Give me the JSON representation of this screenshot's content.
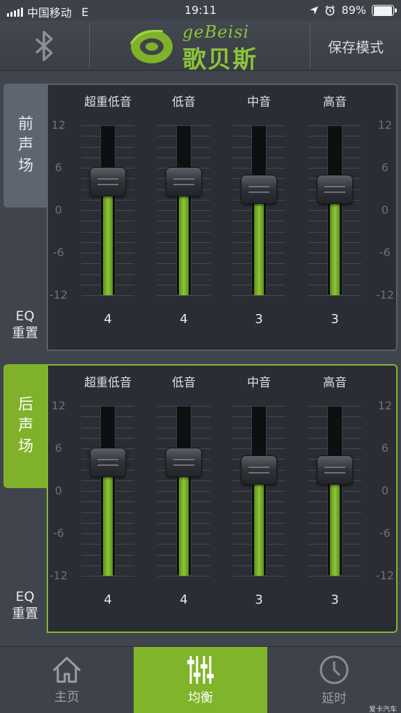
{
  "status_bar": {
    "carrier": "中国移动",
    "network": "E",
    "time": "19:11",
    "battery": "89%",
    "battery_level": 0.89
  },
  "header": {
    "bluetooth_icon": "bluetooth-icon",
    "brand_en": "geBeisi",
    "brand_cn": "歌贝斯",
    "mode_label": "保存模式",
    "accent": "#7fb22a"
  },
  "eq": {
    "scale_labels": [
      "12",
      "6",
      "0",
      "-6",
      "-12"
    ],
    "range": [
      -12,
      12
    ],
    "reset_label_1": "EQ",
    "reset_label_2": "重置",
    "front": {
      "tab_label": [
        "前",
        "声",
        "场"
      ],
      "bands": [
        {
          "label": "超重低音",
          "value": 4
        },
        {
          "label": "低音",
          "value": 4
        },
        {
          "label": "中音",
          "value": 3
        },
        {
          "label": "高音",
          "value": 3
        }
      ]
    },
    "rear": {
      "tab_label": [
        "后",
        "声",
        "场"
      ],
      "bands": [
        {
          "label": "超重低音",
          "value": 4
        },
        {
          "label": "低音",
          "value": 4
        },
        {
          "label": "中音",
          "value": 3
        },
        {
          "label": "高音",
          "value": 3
        }
      ]
    }
  },
  "tabbar": {
    "home": {
      "label": "主页",
      "icon": "home-icon"
    },
    "eq": {
      "label": "均衡",
      "icon": "equalizer-icon"
    },
    "delay": {
      "label": "延时",
      "icon": "clock-icon"
    }
  },
  "watermark": "爱卡汽车"
}
